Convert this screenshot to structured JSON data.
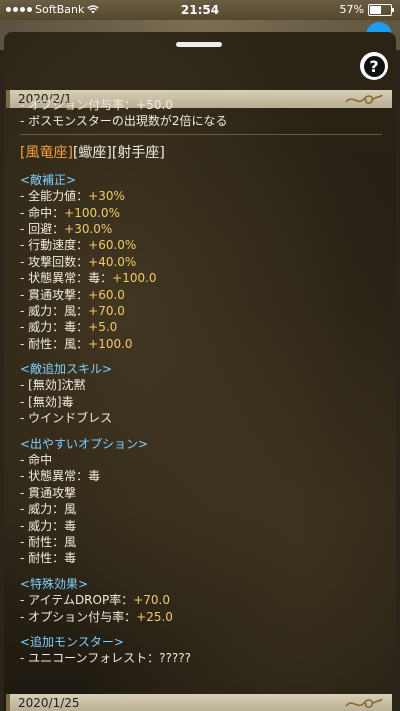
{
  "status": {
    "carrier": "SoftBank",
    "time": "21:54",
    "battery": "57%",
    "battery_level": 0.57
  },
  "help_label": "?",
  "top_date": "2020/2/1",
  "cut_line": "- オプション付与率：+50.0",
  "boss_line": "- ボスモンスターの出現数が2倍になる",
  "zodiac": {
    "current": "[風竜座]",
    "others": "[蠍座][射手座]"
  },
  "enemy_mod": {
    "heading": "<敵補正>",
    "items": [
      {
        "label": "- 全能力値：",
        "value": "+30%"
      },
      {
        "label": "- 命中：",
        "value": "+100.0%"
      },
      {
        "label": "- 回避：",
        "value": "+30.0%"
      },
      {
        "label": "- 行動速度：",
        "value": "+60.0%"
      },
      {
        "label": "- 攻撃回数：",
        "value": "+40.0%"
      },
      {
        "label": "- 状態異常：毒：",
        "value": "+100.0"
      },
      {
        "label": "- 貫通攻撃：",
        "value": "+60.0"
      },
      {
        "label": "- 威力：風：",
        "value": "+70.0"
      },
      {
        "label": "- 威力：毒：",
        "value": "+5.0"
      },
      {
        "label": "- 耐性：風：",
        "value": "+100.0"
      }
    ]
  },
  "enemy_skill": {
    "heading": "<敵追加スキル>",
    "items": [
      "- [無効]沈黙",
      "- [無効]毒",
      "- ウインドブレス"
    ]
  },
  "easy_options": {
    "heading": "<出やすいオプション>",
    "items": [
      "- 命中",
      "- 状態異常：毒",
      "- 貫通攻撃",
      "- 威力：風",
      "- 威力：毒",
      "- 耐性：風",
      "- 耐性：毒"
    ]
  },
  "special": {
    "heading": "<特殊効果>",
    "items": [
      {
        "label": "- アイテムDROP率：",
        "value": "+70.0"
      },
      {
        "label": "- オプション付与率：",
        "value": "+25.0"
      }
    ]
  },
  "add_monster": {
    "heading": "<追加モンスター>",
    "items": [
      "- ユニコーンフォレスト：?????"
    ]
  },
  "bottom_date": "2020/1/25",
  "colors": {
    "value": "#f0c96a",
    "heading": "#7fd0ff",
    "current_zodiac": "#f5a03a",
    "date_bar": "#d8cfb7"
  }
}
